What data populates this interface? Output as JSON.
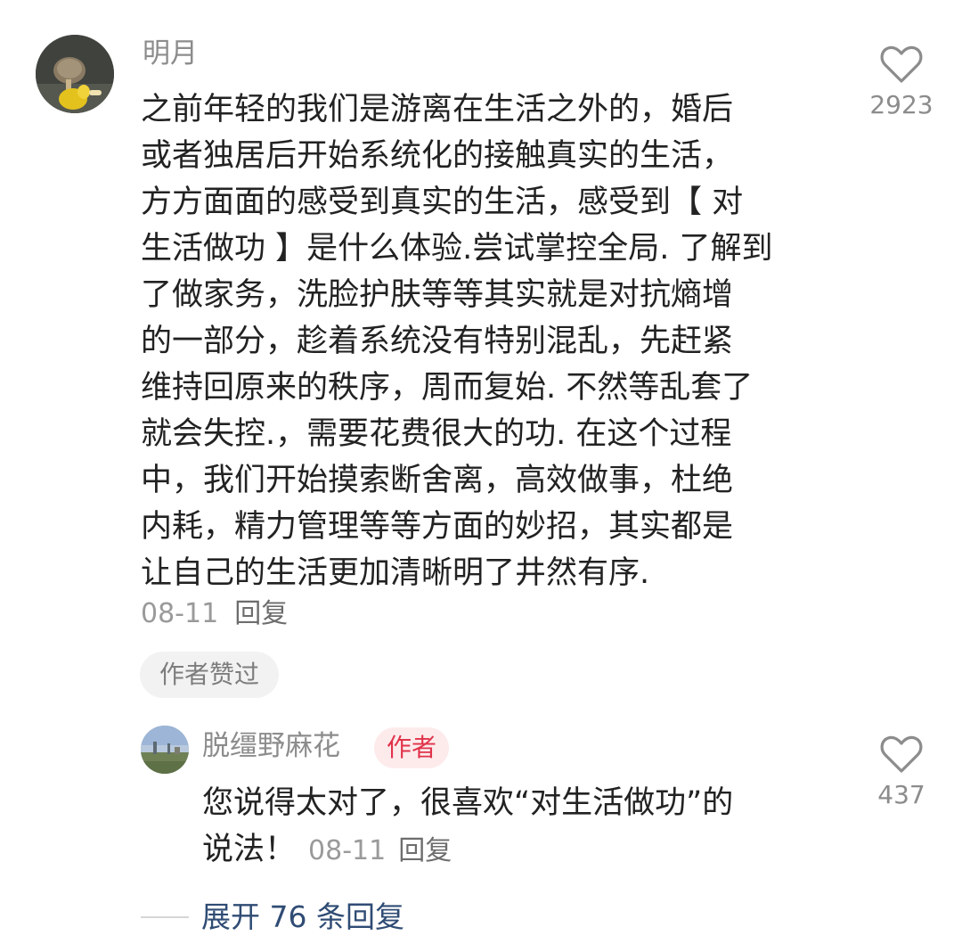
{
  "comment": {
    "username": "明月",
    "text_lines": [
      "之前年轻的我们是游离在生活之外的，婚后",
      "或者独居后开始系统化的接触真实的生活，",
      "方方面面的感受到真实的生活，感受到【 对",
      "生活做功 】是什么体验.尝试掌控全局. 了解到",
      "了做家务，洗脸护肤等等其实就是对抗熵增",
      "的一部分，趁着系统没有特别混乱，先赶紧",
      "维持回原来的秩序，周而复始. 不然等乱套了",
      "就会失控.，需要花费很大的功. 在这个过程",
      "中，我们开始摸索断舍离，高效做事，杜绝",
      "内耗，精力管理等等方面的妙招，其实都是",
      "让自己的生活更加清晰明了井然有序."
    ],
    "date": "08-11",
    "reply_label": "回复",
    "liked_by_author_label": "作者赞过",
    "like_count": "2923",
    "like_icon": "heart-outline-icon"
  },
  "reply": {
    "username": "脱缰野麻花",
    "author_badge": "作者",
    "text_lines": [
      "您说得太对了，很喜欢“对生活做功”的",
      "说法！"
    ],
    "date": "08-11",
    "reply_label": "回复",
    "like_count": "437",
    "like_icon": "heart-outline-icon"
  },
  "expand": {
    "label": "展开 76 条回复"
  },
  "colors": {
    "username": "#8c8c8c",
    "body_text": "#222222",
    "meta": "#9a9a9a",
    "author_badge_text": "#e0334a",
    "author_badge_bg": "#fdebec",
    "expand_link": "#2f4c74",
    "chip_bg": "#f2f2f2"
  }
}
